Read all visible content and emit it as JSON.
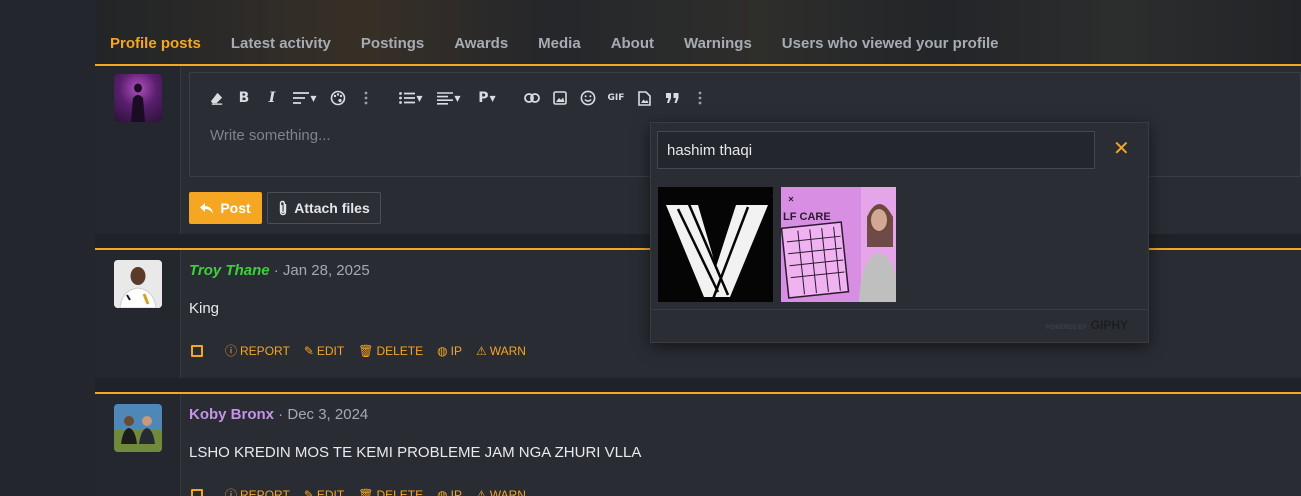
{
  "tabs": [
    {
      "label": "Profile posts",
      "active": true
    },
    {
      "label": "Latest activity"
    },
    {
      "label": "Postings"
    },
    {
      "label": "Awards"
    },
    {
      "label": "Media"
    },
    {
      "label": "About"
    },
    {
      "label": "Warnings"
    },
    {
      "label": "Users who viewed your profile"
    }
  ],
  "editor": {
    "placeholder": "Write something...",
    "toolbar_icons": [
      "eraser-icon",
      "bold-icon",
      "italic-icon",
      "text-size-icon",
      "palette-icon",
      "more-vertical-icon",
      "list-icon",
      "align-icon",
      "paragraph-icon",
      "link-icon",
      "image-icon",
      "smiley-icon",
      "gif-icon",
      "media-icon",
      "quote-icon",
      "more-vertical-icon"
    ],
    "gif_label": "GIF",
    "paragraph_label": "P",
    "post_label": "Post",
    "attach_label": "Attach files"
  },
  "giphy": {
    "search_value": "hashim thaqi",
    "gif2_text": "LF CARE",
    "powered_by": "POWERED BY",
    "brand": "GIPHY"
  },
  "posts": [
    {
      "author": "Troy Thane",
      "date": "Jan 28, 2025",
      "message": "King",
      "author_color": "#3fcf3a"
    },
    {
      "author": "Koby Bronx",
      "date": "Dec 3, 2024",
      "message": "LSHO KREDIN MOS TE KEMI PROBLEME JAM NGA ZHURI VLLA",
      "author_color": "#c792ea"
    }
  ],
  "actions": {
    "report": "REPORT",
    "edit": "EDIT",
    "delete": "DELETE",
    "ip": "IP",
    "warn": "WARN"
  },
  "colors": {
    "accent": "#f5a623",
    "background": "#1f2228",
    "panel": "#292c33"
  }
}
